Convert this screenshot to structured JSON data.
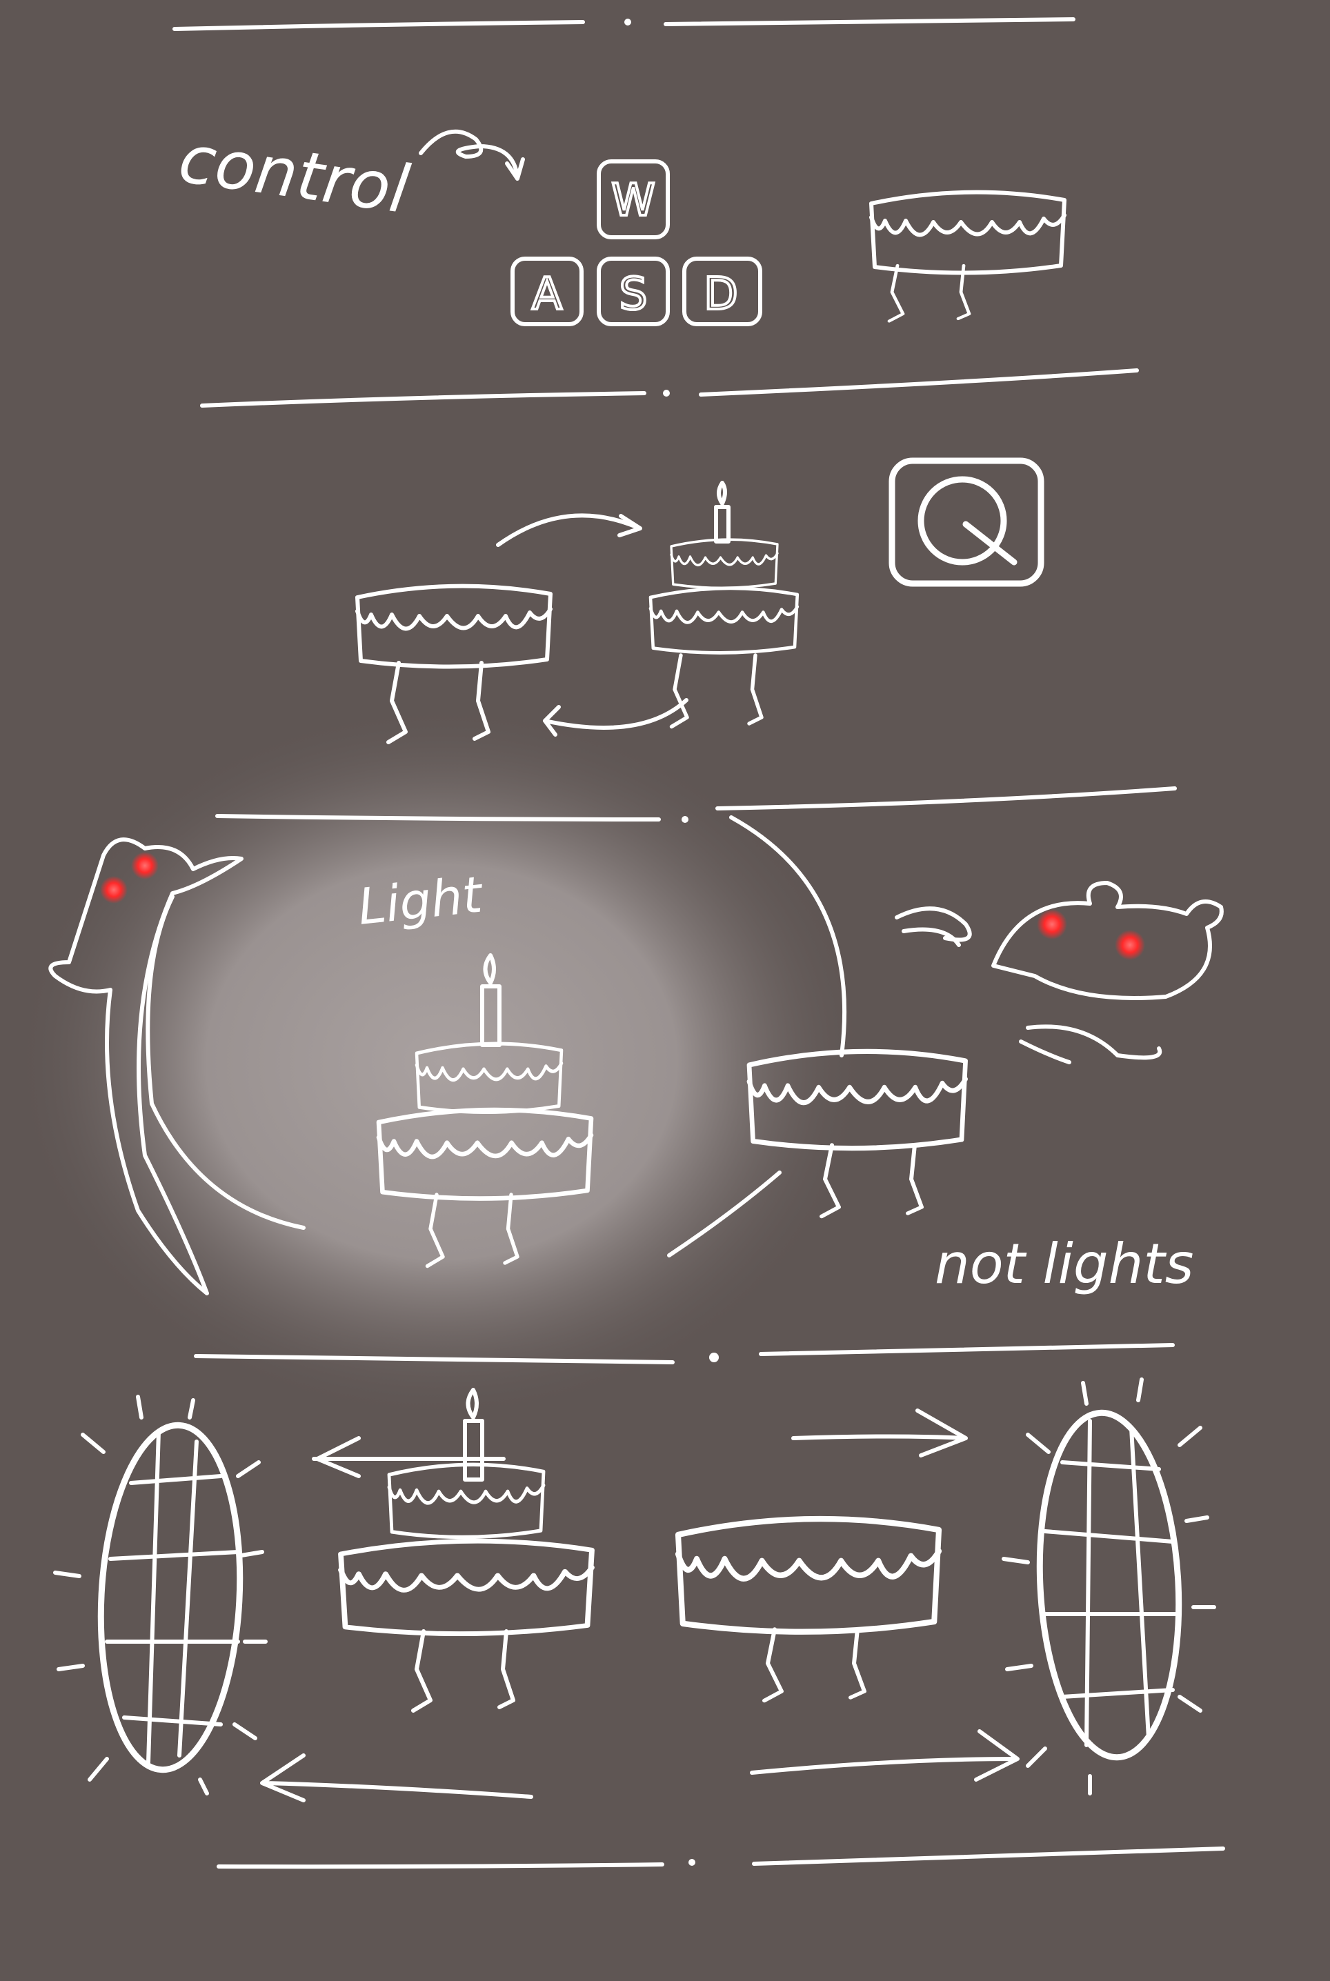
{
  "colors": {
    "background": "#5f5654",
    "ink": "#ffffff",
    "eyes": "#ff2a2a",
    "light_glow": "#b3abaa"
  },
  "controls": {
    "title": "control",
    "keys": {
      "up": "W",
      "left": "A",
      "down": "S",
      "right": "D"
    },
    "switch_key": "Q"
  },
  "light_section": {
    "light_label": "Light",
    "dark_label": "not lights"
  },
  "icons": [
    "arrow-icon",
    "cake-icon",
    "rat-icon",
    "portal-icon",
    "candle-icon"
  ]
}
